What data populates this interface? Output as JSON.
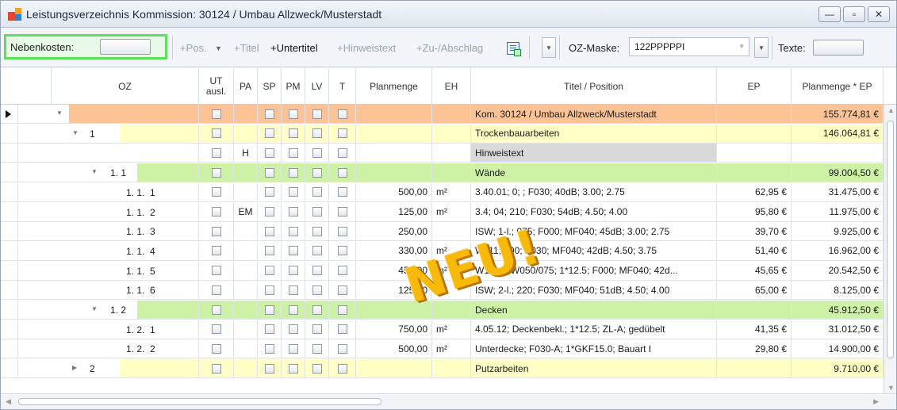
{
  "window": {
    "title": "Leistungsverzeichnis Kommission: 30124 / Umbau Allzweck/Musterstadt",
    "min_glyph": "—",
    "max_glyph": "▫",
    "close_glyph": "✕"
  },
  "toolbar": {
    "nebenkosten_label": "Nebenkosten:",
    "pos_label": "+Pos.",
    "titel_label": "+Titel",
    "untertitel_label": "+Untertitel",
    "hinweis_label": "+Hinweistext",
    "zuab_label": "+Zu-/Abschlag",
    "ozmaske_label": "OZ-Maske:",
    "ozmaske_value": "122PPPPPI",
    "texte_label": "Texte:"
  },
  "columns": {
    "oz": "OZ",
    "ut_1": "UT",
    "ut_2": "ausl.",
    "pa": "PA",
    "sp": "SP",
    "pm": "PM",
    "lv": "LV",
    "t": "T",
    "planmenge": "Planmenge",
    "eh": "EH",
    "titel": "Titel / Position",
    "ep": "EP",
    "total": "Planmenge * EP"
  },
  "rows": [
    {
      "oz": "",
      "pa": "",
      "planmenge": "",
      "eh": "",
      "titel": "Kom. 30124 / Umbau Allzweck/Musterstadt",
      "ep": "",
      "total": "155.774,81 €"
    },
    {
      "oz": "1",
      "pa": "",
      "planmenge": "",
      "eh": "",
      "titel": "Trockenbauarbeiten",
      "ep": "",
      "total": "146.064,81 €"
    },
    {
      "oz": "",
      "pa": "H",
      "planmenge": "",
      "eh": "",
      "titel": "Hinweistext",
      "ep": "",
      "total": ""
    },
    {
      "oz": "1. 1",
      "pa": "",
      "planmenge": "",
      "eh": "",
      "titel": "Wände",
      "ep": "",
      "total": "99.004,50 €"
    },
    {
      "oz": "1. 1.  1",
      "pa": "",
      "planmenge": "500,00",
      "eh": "m²",
      "titel": "3.40.01; 0; ; F030; 40dB; 3.00; 2.75",
      "ep": "62,95 €",
      "total": "31.475,00 €"
    },
    {
      "oz": "1. 1.  2",
      "pa": "EM",
      "planmenge": "125,00",
      "eh": "m²",
      "titel": "3.4; 04; 210; F030; 54dB; 4.50; 4.00",
      "ep": "95,80 €",
      "total": "11.975,00 €"
    },
    {
      "oz": "1. 1.  3",
      "pa": "",
      "planmenge": "250,00",
      "eh": "",
      "titel": "ISW; 1-l.; 075; F000; MF040; 45dB; 3.00; 2.75",
      "ep": "39,70 €",
      "total": "9.925,00 €"
    },
    {
      "oz": "1. 1.  4",
      "pa": "",
      "planmenge": "330,00",
      "eh": "m²",
      "titel": "W111; 100; F030; MF040; 42dB; 4.50; 3.75",
      "ep": "51,40 €",
      "total": "16.962,00 €"
    },
    {
      "oz": "1. 1.  5",
      "pa": "",
      "planmenge": "450,00",
      "eh": "m²",
      "titel": "W111; CW050/075; 1*12.5; F000; MF040; 42d...",
      "ep": "45,65 €",
      "total": "20.542,50 €"
    },
    {
      "oz": "1. 1.  6",
      "pa": "",
      "planmenge": "125,00",
      "eh": "m²",
      "titel": "ISW; 2-l.; 220; F030; MF040; 51dB; 4.50; 4.00",
      "ep": "65,00 €",
      "total": "8.125,00 €"
    },
    {
      "oz": "1. 2",
      "pa": "",
      "planmenge": "",
      "eh": "",
      "titel": "Decken",
      "ep": "",
      "total": "45.912,50 €"
    },
    {
      "oz": "1. 2.  1",
      "pa": "",
      "planmenge": "750,00",
      "eh": "m²",
      "titel": "4.05.12; Deckenbekl.; 1*12.5; ZL-A; gedübelt",
      "ep": "41,35 €",
      "total": "31.012,50 €"
    },
    {
      "oz": "1. 2.  2",
      "pa": "",
      "planmenge": "500,00",
      "eh": "m²",
      "titel": "Unterdecke;  F030-A; 1*GKF15.0; Bauart I",
      "ep": "29,80 €",
      "total": "14.900,00 €"
    },
    {
      "oz": "2",
      "pa": "",
      "planmenge": "",
      "eh": "",
      "titel": "Putzarbeiten",
      "ep": "",
      "total": "9.710,00 €"
    }
  ],
  "badge": "NEU!",
  "colors": {
    "root_row": "#fbc396",
    "title_row": "#ffffc6",
    "subtitle_row": "#cdf2a6",
    "hinweis_cell": "#d9d9d9",
    "nebenkosten_border": "#5de05a",
    "badge": "#f7b90a"
  }
}
